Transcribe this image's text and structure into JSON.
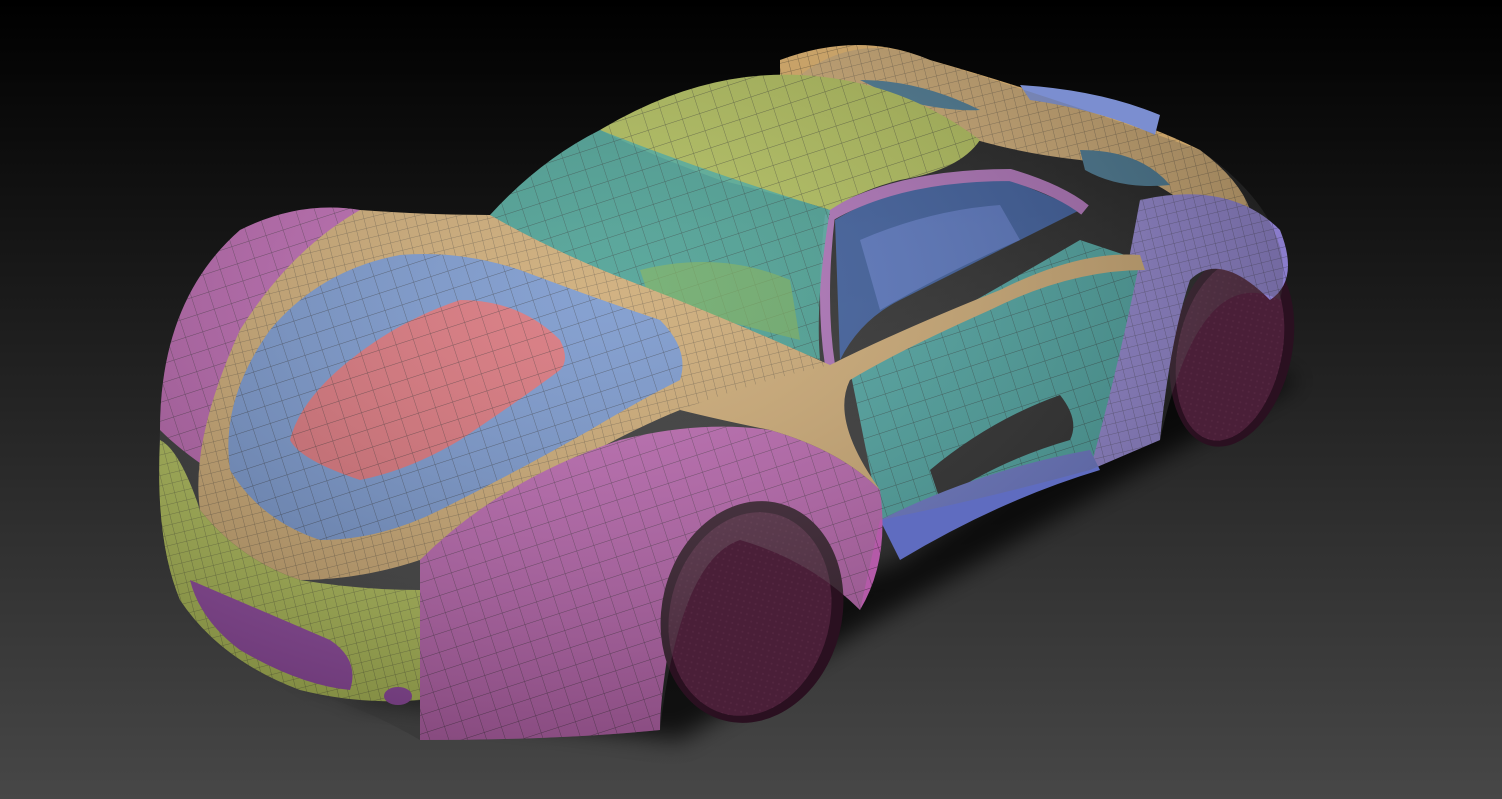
{
  "scene": {
    "background_top": "#000000",
    "background_bottom": "#454545",
    "subject": "car-polygroup-render"
  },
  "colors": {
    "magenta": "#b45aa8",
    "magenta_dark": "#7e3a76",
    "tan": "#c8a268",
    "blue": "#6d8ec8",
    "salmon": "#d66870",
    "lime": "#a9b84c",
    "teal": "#42a6a0",
    "violet": "#8a7ccc",
    "tire": "#3e1a2e"
  }
}
